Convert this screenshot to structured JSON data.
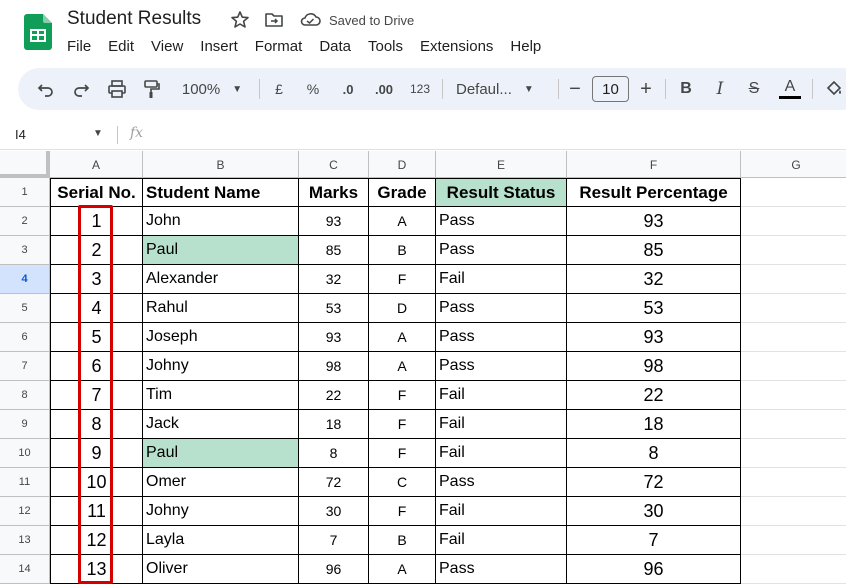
{
  "app": {
    "doc_title": "Student Results",
    "saved_status": "Saved to Drive"
  },
  "menu": [
    "File",
    "Edit",
    "View",
    "Insert",
    "Format",
    "Data",
    "Tools",
    "Extensions",
    "Help"
  ],
  "toolbar": {
    "zoom": "100%",
    "currency": "£",
    "percent": "%",
    "decrease_decimal": ".0",
    "increase_decimal": ".00",
    "number_format": "123",
    "font": "Defaul...",
    "font_size": "10",
    "minus": "−",
    "plus": "+",
    "bold": "B",
    "italic": "I",
    "strike": "S",
    "text_color": "A",
    "text_color_value": "#000000"
  },
  "formula_bar": {
    "cell_ref": "I4",
    "fx": "fx"
  },
  "sheet": {
    "columns": [
      "A",
      "B",
      "C",
      "D",
      "E",
      "F",
      "G"
    ],
    "row_numbers": [
      "1",
      "2",
      "3",
      "4",
      "5",
      "6",
      "7",
      "8",
      "9",
      "10",
      "11",
      "12",
      "13",
      "14"
    ],
    "active_row": "4",
    "headers": [
      "Serial No.",
      "Student  Name",
      "Marks",
      "Grade",
      "Result Status",
      "Result Percentage"
    ],
    "rows": [
      [
        "1",
        "John",
        "93",
        "A",
        "Pass",
        "93"
      ],
      [
        "2",
        "Paul",
        "85",
        "B",
        "Pass",
        "85"
      ],
      [
        "3",
        "Alexander",
        "32",
        "F",
        "Fail",
        "32"
      ],
      [
        "4",
        "Rahul",
        "53",
        "D",
        "Pass",
        "53"
      ],
      [
        "5",
        "Joseph",
        "93",
        "A",
        "Pass",
        "93"
      ],
      [
        "6",
        "Johny",
        "98",
        "A",
        "Pass",
        "98"
      ],
      [
        "7",
        "Tim",
        "22",
        "F",
        "Fail",
        "22"
      ],
      [
        "8",
        "Jack",
        "18",
        "F",
        "Fail",
        "18"
      ],
      [
        "9",
        "Paul",
        "8",
        "F",
        "Fail",
        "8"
      ],
      [
        "10",
        "Omer",
        "72",
        "C",
        "Pass",
        "72"
      ],
      [
        "11",
        "Johny",
        "30",
        "F",
        "Fail",
        "30"
      ],
      [
        "12",
        "Layla",
        "7",
        "B",
        "Fail",
        "7"
      ],
      [
        "13",
        "Oliver",
        "96",
        "A",
        "Pass",
        "96"
      ]
    ],
    "highlighted_name_rows": [
      1,
      8
    ],
    "colors": {
      "highlight_green": "#b7e1cd",
      "result_status_header_bg": "#b7e1cd",
      "serial_outline_red": "#d40000",
      "active_row_header": "#d3e3fd"
    }
  }
}
